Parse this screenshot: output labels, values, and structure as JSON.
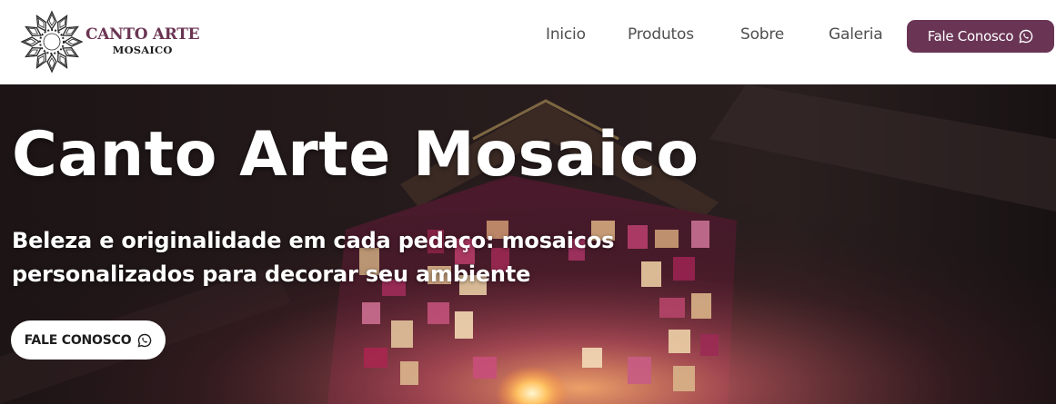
{
  "brand": {
    "title": "CANTO ARTE",
    "subtitle": "MOSAICO",
    "title_color": "#6b3553"
  },
  "nav": {
    "items": [
      {
        "label": "Inicio"
      },
      {
        "label": "Produtos"
      },
      {
        "label": "Sobre"
      },
      {
        "label": "Galeria"
      }
    ],
    "cta": {
      "label": "Fale Conosco",
      "icon": "whatsapp-icon",
      "background": "#6a3555"
    }
  },
  "hero": {
    "title": "Canto Arte Mosaico",
    "subtitle": "Beleza e originalidade em cada pedaço: mosaicos personalizados para decorar seu ambiente",
    "cta": {
      "label": "FALE CONOSCO",
      "icon": "whatsapp-icon"
    },
    "background_image": "mosaic-lantern-photo"
  }
}
